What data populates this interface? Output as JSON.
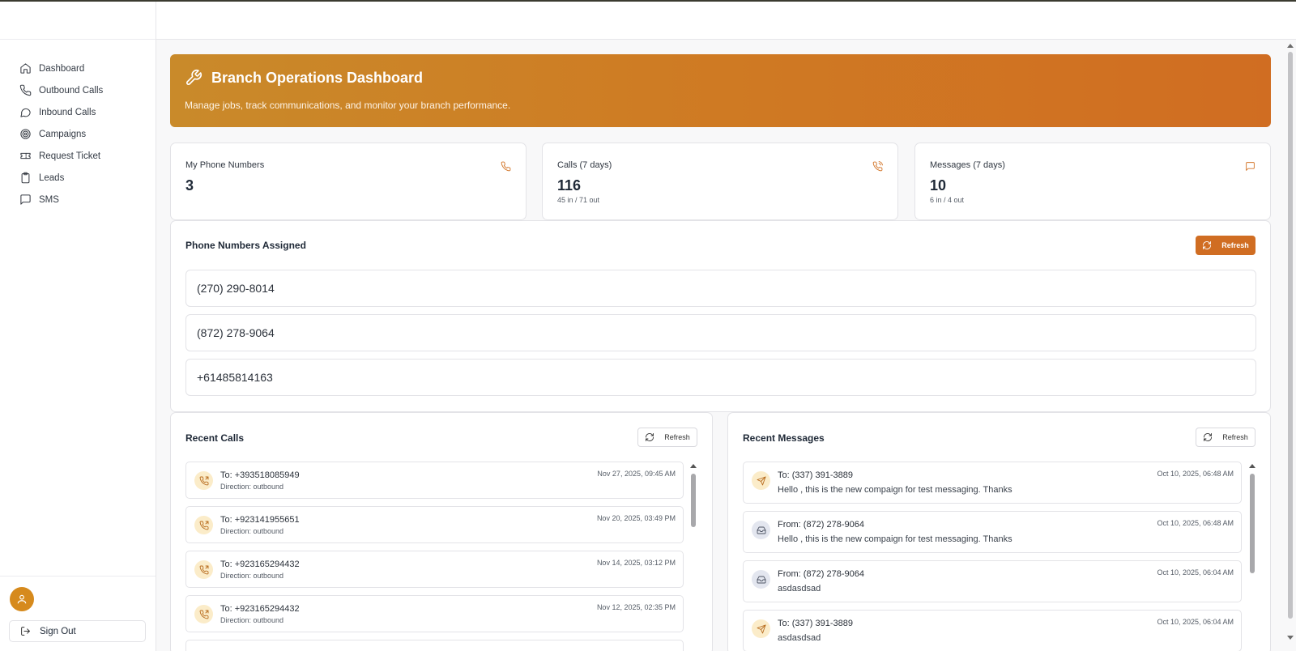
{
  "sidebar": {
    "items": [
      {
        "label": "Dashboard",
        "icon": "home-icon"
      },
      {
        "label": "Outbound Calls",
        "icon": "phone-icon"
      },
      {
        "label": "Inbound Calls",
        "icon": "chat-bubble-icon"
      },
      {
        "label": "Campaigns",
        "icon": "target-icon"
      },
      {
        "label": "Request Ticket",
        "icon": "ticket-icon"
      },
      {
        "label": "Leads",
        "icon": "clipboard-icon"
      },
      {
        "label": "SMS",
        "icon": "message-square-icon"
      }
    ],
    "sign_out": "Sign Out"
  },
  "hero": {
    "title": "Branch Operations Dashboard",
    "subtitle": "Manage jobs, track communications, and monitor your branch performance."
  },
  "stats": [
    {
      "label": "My Phone Numbers",
      "value": "3",
      "sub": "",
      "icon": "phone-icon"
    },
    {
      "label": "Calls (7 days)",
      "value": "116",
      "sub": "45 in / 71 out",
      "icon": "phone-call-icon"
    },
    {
      "label": "Messages (7 days)",
      "value": "10",
      "sub": "6 in / 4 out",
      "icon": "message-square-icon"
    }
  ],
  "phones": {
    "title": "Phone Numbers Assigned",
    "refresh": "Refresh",
    "numbers": [
      "(270) 290-8014",
      "(872) 278-9064",
      "+61485814163"
    ]
  },
  "recent_calls": {
    "title": "Recent Calls",
    "refresh": "Refresh",
    "items": [
      {
        "to": "To: +393518085949",
        "direction": "Direction: outbound",
        "time": "Nov 27, 2025, 09:45 AM"
      },
      {
        "to": "To: +923141955651",
        "direction": "Direction: outbound",
        "time": "Nov 20, 2025, 03:49 PM"
      },
      {
        "to": "To: +923165294432",
        "direction": "Direction: outbound",
        "time": "Nov 14, 2025, 03:12 PM"
      },
      {
        "to": "To: +923165294432",
        "direction": "Direction: outbound",
        "time": "Nov 12, 2025, 02:35 PM"
      }
    ]
  },
  "recent_messages": {
    "title": "Recent Messages",
    "refresh": "Refresh",
    "items": [
      {
        "party": "To: (337) 391-3889",
        "body": "Hello , this is the new compaign for test messaging. Thanks",
        "time": "Oct 10, 2025, 06:48 AM",
        "kind": "outgoing"
      },
      {
        "party": "From: (872) 278-9064",
        "body": "Hello , this is the new compaign for test messaging. Thanks",
        "time": "Oct 10, 2025, 06:48 AM",
        "kind": "incoming"
      },
      {
        "party": "From: (872) 278-9064",
        "body": "asdasdsad",
        "time": "Oct 10, 2025, 06:04 AM",
        "kind": "incoming"
      },
      {
        "party": "To: (337) 391-3889",
        "body": "asdasdsad",
        "time": "Oct 10, 2025, 06:04 AM",
        "kind": "outgoing"
      }
    ]
  },
  "colors": {
    "accent": "#d06d22",
    "icon_bg_warm": "#fbecc9",
    "icon_bg_cool": "#e3e6ef"
  }
}
